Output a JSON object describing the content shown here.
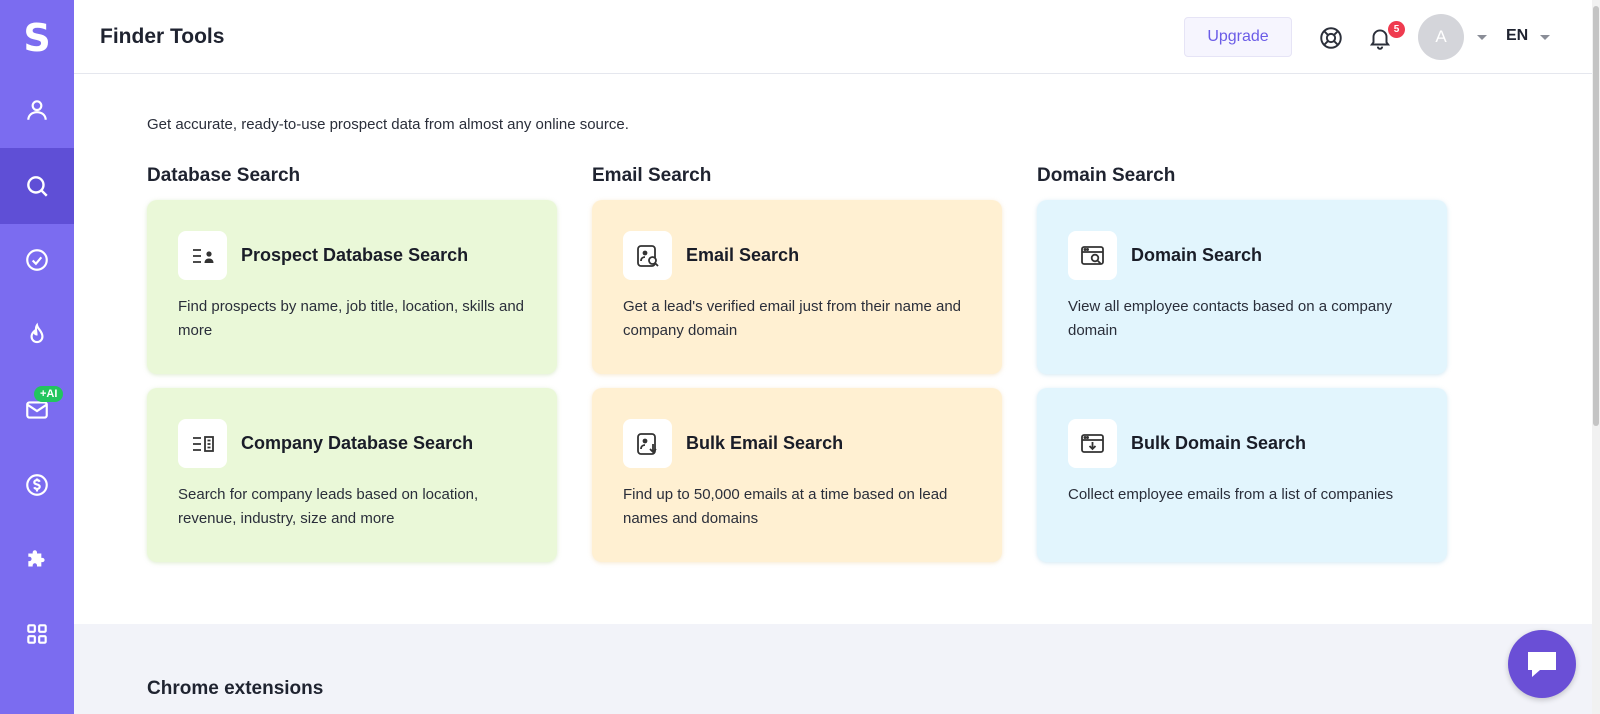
{
  "app": {
    "logo": "S"
  },
  "sidebar": {
    "items": [
      {
        "icon": "user-icon"
      },
      {
        "icon": "search-icon",
        "active": true
      },
      {
        "icon": "check-circle-icon"
      },
      {
        "icon": "flame-icon"
      },
      {
        "icon": "mail-icon",
        "badge": "+AI"
      },
      {
        "icon": "dollar-icon"
      },
      {
        "icon": "puzzle-icon"
      },
      {
        "icon": "apps-grid-icon"
      }
    ]
  },
  "header": {
    "title": "Finder Tools",
    "upgrade_label": "Upgrade",
    "notification_count": "5",
    "avatar_initial": "A",
    "language": "EN"
  },
  "main": {
    "intro": "Get accurate, ready-to-use prospect data from almost any online source.",
    "columns": [
      {
        "title": "Database Search",
        "cards": [
          {
            "title": "Prospect Database Search",
            "description": "Find prospects by name, job title, location, skills and more",
            "icon": "prospect-list-icon"
          },
          {
            "title": "Company Database Search",
            "description": "Search for company leads based on location, revenue, industry, size and more",
            "icon": "company-list-icon"
          }
        ]
      },
      {
        "title": "Email Search",
        "cards": [
          {
            "title": "Email Search",
            "description": "Get a lead's verified email just from their name and company domain",
            "icon": "email-search-icon"
          },
          {
            "title": "Bulk Email Search",
            "description": "Find up to 50,000 emails at a time based on lead names and domains",
            "icon": "bulk-email-search-icon"
          }
        ]
      },
      {
        "title": "Domain Search",
        "cards": [
          {
            "title": "Domain Search",
            "description": "View all employee contacts based on a company domain",
            "icon": "domain-search-icon"
          },
          {
            "title": "Bulk Domain Search",
            "description": "Collect employee emails from a list of companies",
            "icon": "bulk-domain-search-icon"
          }
        ]
      }
    ],
    "extensions_title": "Chrome extensions"
  },
  "colors": {
    "sidebar": "#7b6cf0",
    "sidebar_active": "#5f4fd6",
    "accent": "#6b5ce7",
    "card_green": "#eaf8d8",
    "card_orange": "#fff0d2",
    "card_blue": "#e2f5fd",
    "badge_red": "#ef3b4f",
    "ai_badge": "#22c55e"
  }
}
